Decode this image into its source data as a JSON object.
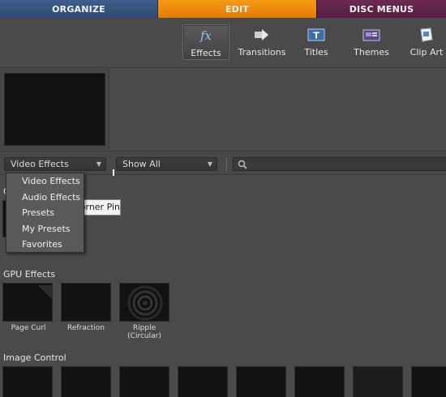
{
  "mode_tabs": [
    "ORGANIZE",
    "EDIT",
    "DISC MENUS"
  ],
  "toolbar": {
    "effects": "Effects",
    "transitions": "Transitions",
    "titles": "Titles",
    "themes": "Themes",
    "clip_art": "Clip Art"
  },
  "filters": {
    "category": "Video Effects",
    "show": "Show All",
    "search_value": ""
  },
  "category_menu": [
    "Video Effects",
    "Audio Effects",
    "Presets",
    "My Presets",
    "Favorites"
  ],
  "tooltip": "Corner Pin",
  "sections": {
    "first_letter": "C",
    "gpu": {
      "title": "GPU Effects",
      "items": [
        "Page Curl",
        "Refraction",
        "Ripple",
        "(Circular)"
      ]
    },
    "image_control": {
      "title": "Image Control"
    }
  },
  "colors": {
    "edit_tab": "#e88707",
    "organize_tab": "#35547f",
    "disc_menus_tab": "#5f2148",
    "panel_bg": "#4a4a4a",
    "effects_icon": "#8fc4f2"
  }
}
